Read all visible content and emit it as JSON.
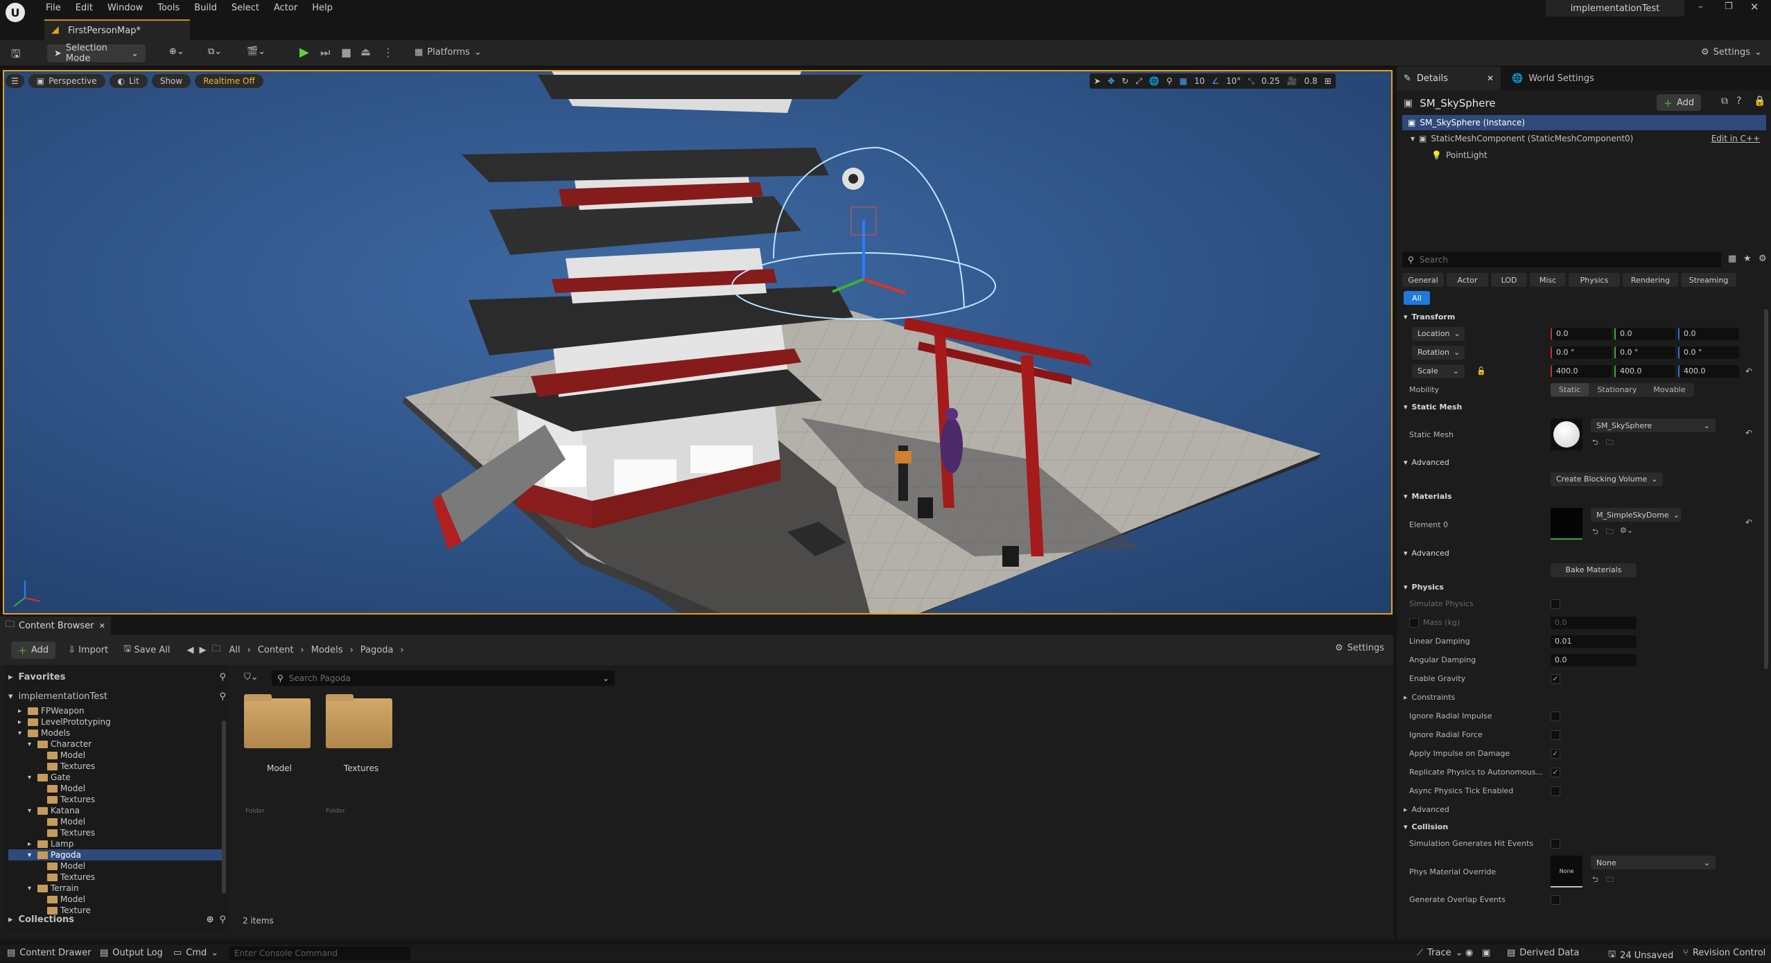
{
  "app": {
    "project": "implementationTest",
    "map_tab": "FirstPersonMap*"
  },
  "menu": [
    "File",
    "Edit",
    "Window",
    "Tools",
    "Build",
    "Select",
    "Actor",
    "Help"
  ],
  "toolbar": {
    "selection_mode": "Selection Mode",
    "platforms": "Platforms",
    "settings": "Settings"
  },
  "viewport": {
    "perspective": "Perspective",
    "lit": "Lit",
    "show": "Show",
    "realtime": "Realtime Off",
    "grid_snap": "10",
    "rot_snap": "10°",
    "scale_snap": "0.25",
    "cam_speed": "0.8"
  },
  "details": {
    "tab": "Details",
    "world_tab": "World Settings",
    "add": "Add",
    "actor": "SM_SkySphere",
    "components": [
      "SM_SkySphere (Instance)",
      "StaticMeshComponent (StaticMeshComponent0)",
      "PointLight"
    ],
    "edit_cpp": "Edit in C++",
    "search_placeholder": "Search",
    "filters": [
      "General",
      "Actor",
      "LOD",
      "Misc",
      "Physics",
      "Rendering",
      "Streaming"
    ],
    "filter_all": "All",
    "transform": {
      "title": "Transform",
      "location": {
        "label": "Location",
        "x": "0.0",
        "y": "0.0",
        "z": "0.0"
      },
      "rotation": {
        "label": "Rotation",
        "x": "0.0 °",
        "y": "0.0 °",
        "z": "0.0 °"
      },
      "scale": {
        "label": "Scale",
        "x": "400.0",
        "y": "400.0",
        "z": "400.0"
      },
      "mobility": {
        "label": "Mobility",
        "options": [
          "Static",
          "Stationary",
          "Movable"
        ],
        "selected": "Static"
      }
    },
    "static_mesh": {
      "title": "Static Mesh",
      "label": "Static Mesh",
      "value": "SM_SkySphere",
      "advanced": "Advanced",
      "blocking": "Create Blocking Volume"
    },
    "materials": {
      "title": "Materials",
      "element": "Element 0",
      "value": "M_SimpleSkyDome",
      "advanced": "Advanced",
      "bake": "Bake Materials"
    },
    "physics": {
      "title": "Physics",
      "simulate": "Simulate Physics",
      "mass": "Mass (kg)",
      "mass_val": "0.0",
      "linear": "Linear Damping",
      "linear_val": "0.01",
      "angular": "Angular Damping",
      "angular_val": "0.0",
      "gravity": "Enable Gravity",
      "constraints": "Constraints",
      "ignore_impulse": "Ignore Radial Impulse",
      "ignore_force": "Ignore Radial Force",
      "apply_impulse": "Apply Impulse on Damage",
      "replicate": "Replicate Physics to Autonomous...",
      "async": "Async Physics Tick Enabled",
      "advanced": "Advanced"
    },
    "collision": {
      "title": "Collision",
      "hit_events": "Simulation Generates Hit Events",
      "phys_override": "Phys Material Override",
      "phys_value": "None",
      "phys_thumb": "None",
      "overlap": "Generate Overlap Events"
    }
  },
  "content_browser": {
    "tab": "Content Browser",
    "add": "Add",
    "import": "Import",
    "save_all": "Save All",
    "path": [
      "All",
      "Content",
      "Models",
      "Pagoda"
    ],
    "settings": "Settings",
    "favorites": "Favorites",
    "root": "implementationTest",
    "tree": [
      {
        "label": "FPWeapon",
        "depth": 1,
        "open": false
      },
      {
        "label": "LevelPrototyping",
        "depth": 1,
        "open": false
      },
      {
        "label": "Models",
        "depth": 1,
        "open": true
      },
      {
        "label": "Character",
        "depth": 2,
        "open": true
      },
      {
        "label": "Model",
        "depth": 3
      },
      {
        "label": "Textures",
        "depth": 3
      },
      {
        "label": "Gate",
        "depth": 2,
        "open": true
      },
      {
        "label": "Model",
        "depth": 3
      },
      {
        "label": "Textures",
        "depth": 3
      },
      {
        "label": "Katana",
        "depth": 2,
        "open": true
      },
      {
        "label": "Model",
        "depth": 3
      },
      {
        "label": "Textures",
        "depth": 3
      },
      {
        "label": "Lamp",
        "depth": 2,
        "open": false
      },
      {
        "label": "Pagoda",
        "depth": 2,
        "open": true,
        "selected": true
      },
      {
        "label": "Model",
        "depth": 3
      },
      {
        "label": "Textures",
        "depth": 3
      },
      {
        "label": "Terrain",
        "depth": 2,
        "open": true
      },
      {
        "label": "Model",
        "depth": 3
      },
      {
        "label": "Texture",
        "depth": 3
      }
    ],
    "collections": "Collections",
    "search_placeholder": "Search Pagoda",
    "assets": [
      {
        "name": "Model",
        "type": "Folder"
      },
      {
        "name": "Textures",
        "type": "Folder"
      }
    ],
    "count": "2 items"
  },
  "status": {
    "content_drawer": "Content Drawer",
    "output_log": "Output Log",
    "cmd": "Cmd",
    "console_placeholder": "Enter Console Command",
    "trace": "Trace",
    "derived": "Derived Data",
    "unsaved": "24 Unsaved",
    "revision": "Revision Control"
  }
}
